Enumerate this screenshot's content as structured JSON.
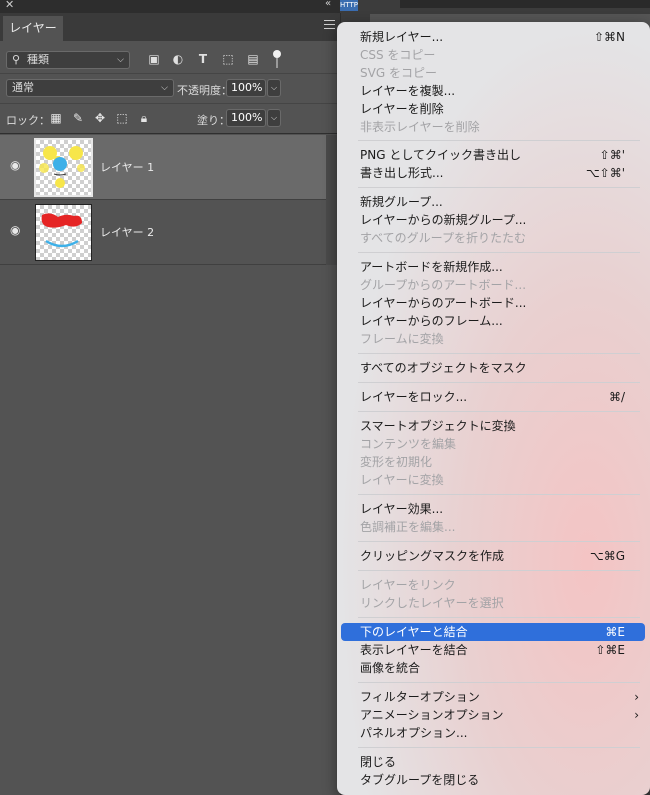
{
  "panel": {
    "tab_label": "レイヤー",
    "kind_filter": "種類",
    "blend_mode": "通常",
    "opacity_label": "不透明度：",
    "opacity_value": "100%",
    "lock_label": "ロック：",
    "fill_label": "塗り：",
    "fill_value": "100%",
    "layers": [
      {
        "name": "レイヤー 1",
        "selected": true
      },
      {
        "name": "レイヤー 2",
        "selected": false
      }
    ]
  },
  "topbar": {
    "right_tag": "HTTP"
  },
  "menu": {
    "items": [
      {
        "label": "新規レイヤー...",
        "shortcut": "⇧⌘N",
        "disabled": false
      },
      {
        "label": "CSS をコピー",
        "shortcut": "",
        "disabled": true
      },
      {
        "label": "SVG をコピー",
        "shortcut": "",
        "disabled": true
      },
      {
        "label": "レイヤーを複製...",
        "shortcut": "",
        "disabled": false
      },
      {
        "label": "レイヤーを削除",
        "shortcut": "",
        "disabled": false
      },
      {
        "label": "非表示レイヤーを削除",
        "shortcut": "",
        "disabled": true
      },
      {
        "label": "PNG としてクイック書き出し",
        "shortcut": "⇧⌘'",
        "disabled": false
      },
      {
        "label": "書き出し形式...",
        "shortcut": "⌥⇧⌘'",
        "disabled": false
      },
      {
        "label": "新規グループ...",
        "shortcut": "",
        "disabled": false
      },
      {
        "label": "レイヤーからの新規グループ...",
        "shortcut": "",
        "disabled": false
      },
      {
        "label": "すべてのグループを折りたたむ",
        "shortcut": "",
        "disabled": true
      },
      {
        "label": "アートボードを新規作成...",
        "shortcut": "",
        "disabled": false
      },
      {
        "label": "グループからのアートボード...",
        "shortcut": "",
        "disabled": true
      },
      {
        "label": "レイヤーからのアートボード...",
        "shortcut": "",
        "disabled": false
      },
      {
        "label": "レイヤーからのフレーム...",
        "shortcut": "",
        "disabled": false
      },
      {
        "label": "フレームに変換",
        "shortcut": "",
        "disabled": true
      },
      {
        "label": "すべてのオブジェクトをマスク",
        "shortcut": "",
        "disabled": false
      },
      {
        "label": "レイヤーをロック...",
        "shortcut": "⌘/",
        "disabled": false
      },
      {
        "label": "スマートオブジェクトに変換",
        "shortcut": "",
        "disabled": false
      },
      {
        "label": "コンテンツを編集",
        "shortcut": "",
        "disabled": true
      },
      {
        "label": "変形を初期化",
        "shortcut": "",
        "disabled": true
      },
      {
        "label": "レイヤーに変換",
        "shortcut": "",
        "disabled": true
      },
      {
        "label": "レイヤー効果...",
        "shortcut": "",
        "disabled": false
      },
      {
        "label": "色調補正を編集...",
        "shortcut": "",
        "disabled": true
      },
      {
        "label": "クリッピングマスクを作成",
        "shortcut": "⌥⌘G",
        "disabled": false
      },
      {
        "label": "レイヤーをリンク",
        "shortcut": "",
        "disabled": true
      },
      {
        "label": "リンクしたレイヤーを選択",
        "shortcut": "",
        "disabled": true
      },
      {
        "label": "下のレイヤーと結合",
        "shortcut": "⌘E",
        "disabled": false,
        "highlighted": true
      },
      {
        "label": "表示レイヤーを結合",
        "shortcut": "⇧⌘E",
        "disabled": false
      },
      {
        "label": "画像を統合",
        "shortcut": "",
        "disabled": false
      },
      {
        "label": "フィルターオプション",
        "shortcut": "",
        "disabled": false,
        "submenu": true
      },
      {
        "label": "アニメーションオプション",
        "shortcut": "",
        "disabled": false,
        "submenu": true
      },
      {
        "label": "パネルオプション...",
        "shortcut": "",
        "disabled": false
      },
      {
        "label": "閉じる",
        "shortcut": "",
        "disabled": false
      },
      {
        "label": "タブグループを閉じる",
        "shortcut": "",
        "disabled": false
      }
    ]
  },
  "colors": {
    "highlight": "#2f6fdb",
    "panel_bg": "#535353",
    "selected_layer": "#6a6a6a"
  }
}
